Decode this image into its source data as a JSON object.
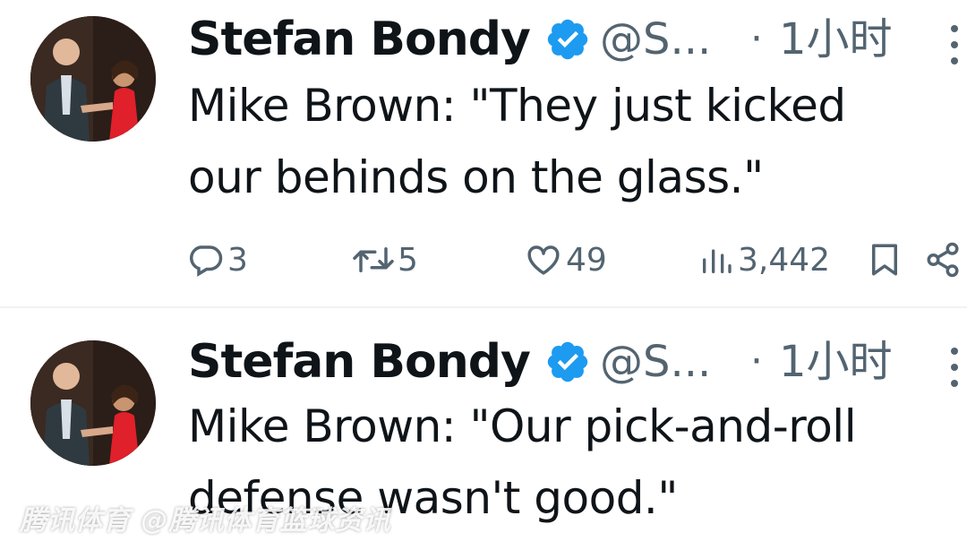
{
  "tweets": [
    {
      "author_name": "Stefan Bondy",
      "handle": "@S...",
      "separator": "·",
      "time": "1小时",
      "text_lines": [
        "Mike Brown: \"They just kicked",
        "our behinds on the glass.\""
      ],
      "replies": "3",
      "reposts": "5",
      "likes": "49",
      "views": "3,442"
    },
    {
      "author_name": "Stefan Bondy",
      "handle": "@S...",
      "separator": "·",
      "time": "1小时",
      "text_lines": [
        "Mike Brown: \"Our pick-and-roll",
        "defense wasn't good.\""
      ]
    }
  ],
  "watermark": "腾讯体育 @腾讯体育篮球资讯",
  "colors": {
    "text": "#0f1419",
    "secondary": "#536471",
    "verified": "#1d9bf0",
    "divider": "#eff3f4"
  },
  "icons": [
    "verified-badge-icon",
    "more-options-icon",
    "reply-icon",
    "repost-icon",
    "like-icon",
    "views-icon",
    "bookmark-icon",
    "share-icon"
  ]
}
